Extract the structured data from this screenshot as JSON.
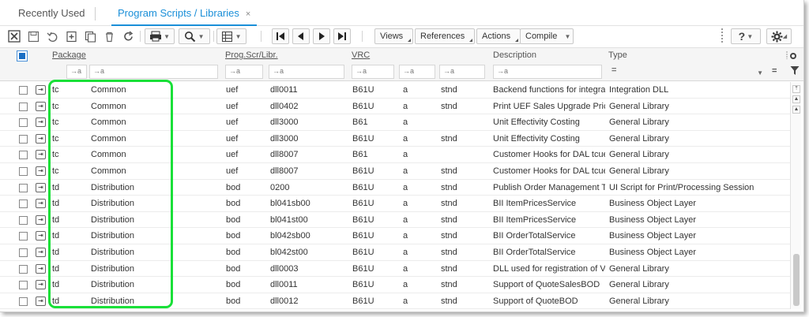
{
  "tabs": {
    "recent": "Recently Used",
    "active": "Program Scripts / Libraries",
    "close": "×"
  },
  "toolbar": {
    "views": "Views",
    "references": "References",
    "actions": "Actions",
    "compile": "Compile",
    "help": "?"
  },
  "columns": {
    "package": "Package",
    "prog": "Prog.Scr/Libr.",
    "vrc": "VRC",
    "description": "Description",
    "type": "Type"
  },
  "filter_hint": "→a",
  "filter_type": "=",
  "rows": [
    {
      "pkg": "tc",
      "pkg_desc": "Common",
      "module": "uef",
      "prog": "dll0011",
      "vrc": "B61U",
      "c1": "a",
      "c2": "stnd",
      "desc": "Backend functions for integrati",
      "type": "Integration DLL"
    },
    {
      "pkg": "tc",
      "pkg_desc": "Common",
      "module": "uef",
      "prog": "dll0402",
      "vrc": "B61U",
      "c1": "a",
      "c2": "stnd",
      "desc": "Print UEF Sales Upgrade Price",
      "type": "General Library"
    },
    {
      "pkg": "tc",
      "pkg_desc": "Common",
      "module": "uef",
      "prog": "dll3000",
      "vrc": "B61",
      "c1": "a",
      "c2": "",
      "desc": "Unit Effectivity Costing",
      "type": "General Library"
    },
    {
      "pkg": "tc",
      "pkg_desc": "Common",
      "module": "uef",
      "prog": "dll3000",
      "vrc": "B61U",
      "c1": "a",
      "c2": "stnd",
      "desc": "Unit Effectivity Costing",
      "type": "General Library"
    },
    {
      "pkg": "tc",
      "pkg_desc": "Common",
      "module": "uef",
      "prog": "dll8007",
      "vrc": "B61",
      "c1": "a",
      "c2": "",
      "desc": "Customer Hooks for DAL tcuef",
      "type": "General Library"
    },
    {
      "pkg": "tc",
      "pkg_desc": "Common",
      "module": "uef",
      "prog": "dll8007",
      "vrc": "B61U",
      "c1": "a",
      "c2": "stnd",
      "desc": "Customer Hooks for DAL tcuef",
      "type": "General Library"
    },
    {
      "pkg": "td",
      "pkg_desc": "Distribution",
      "module": "bod",
      "prog": "0200",
      "vrc": "B61U",
      "c1": "a",
      "c2": "stnd",
      "desc": "Publish Order Management Tr",
      "type": "UI Script for Print/Processing Session"
    },
    {
      "pkg": "td",
      "pkg_desc": "Distribution",
      "module": "bod",
      "prog": "bl041sb00",
      "vrc": "B61U",
      "c1": "a",
      "c2": "stnd",
      "desc": "BII ItemPricesService",
      "type": "Business Object Layer"
    },
    {
      "pkg": "td",
      "pkg_desc": "Distribution",
      "module": "bod",
      "prog": "bl041st00",
      "vrc": "B61U",
      "c1": "a",
      "c2": "stnd",
      "desc": "BII ItemPricesService",
      "type": "Business Object Layer"
    },
    {
      "pkg": "td",
      "pkg_desc": "Distribution",
      "module": "bod",
      "prog": "bl042sb00",
      "vrc": "B61U",
      "c1": "a",
      "c2": "stnd",
      "desc": "BII OrderTotalService",
      "type": "Business Object Layer"
    },
    {
      "pkg": "td",
      "pkg_desc": "Distribution",
      "module": "bod",
      "prog": "bl042st00",
      "vrc": "B61U",
      "c1": "a",
      "c2": "stnd",
      "desc": "BII OrderTotalService",
      "type": "Business Object Layer"
    },
    {
      "pkg": "td",
      "pkg_desc": "Distribution",
      "module": "bod",
      "prog": "dll0003",
      "vrc": "B61U",
      "c1": "a",
      "c2": "stnd",
      "desc": "DLL used for registration of Vie",
      "type": "General Library"
    },
    {
      "pkg": "td",
      "pkg_desc": "Distribution",
      "module": "bod",
      "prog": "dll0011",
      "vrc": "B61U",
      "c1": "a",
      "c2": "stnd",
      "desc": "Support of QuoteSalesBOD",
      "type": "General Library"
    },
    {
      "pkg": "td",
      "pkg_desc": "Distribution",
      "module": "bod",
      "prog": "dll0012",
      "vrc": "B61U",
      "c1": "a",
      "c2": "stnd",
      "desc": "Support of QuoteBOD",
      "type": "General Library"
    }
  ],
  "colors": {
    "accent": "#1a8fd8",
    "highlight": "#19e038"
  }
}
